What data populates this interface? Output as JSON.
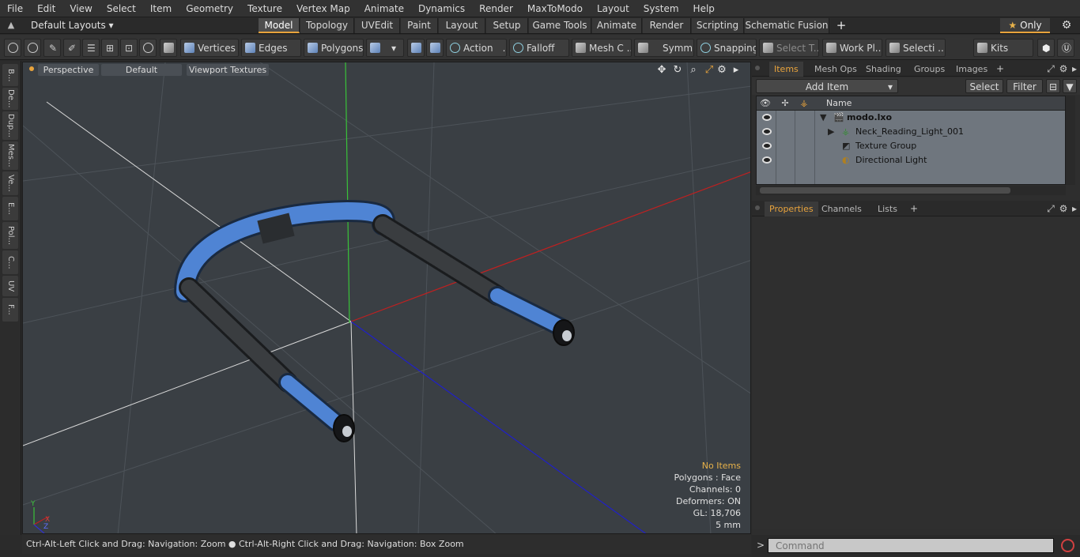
{
  "menu": [
    "File",
    "Edit",
    "View",
    "Select",
    "Item",
    "Geometry",
    "Texture",
    "Vertex Map",
    "Animate",
    "Dynamics",
    "Render",
    "MaxToModo",
    "Layout",
    "System",
    "Help"
  ],
  "layouts": {
    "label": "Default Layouts"
  },
  "mode_tabs": [
    "Model",
    "Topology",
    "UVEdit",
    "Paint",
    "Layout",
    "Setup",
    "Game Tools",
    "Animate",
    "Render",
    "Scripting",
    "Schematic Fusion"
  ],
  "mode_active": "Model",
  "only_label": "Only",
  "toolbar": {
    "vertices": "Vertices",
    "edges": "Edges",
    "polygons": "Polygons",
    "action": "Action",
    "falloff": "Falloff",
    "mesh": "Mesh C ...",
    "symm": "Symm ...",
    "snapping": "Snapping",
    "select_t": "Select T...",
    "work_pl": "Work Pl...",
    "selecti": "Selecti ...",
    "kits": "Kits",
    "action_more": "..."
  },
  "left_tabs": [
    "B...",
    "De...",
    "Dup...",
    "Mes...",
    "Ve...",
    "E...",
    "Pol...",
    "C...",
    "UV",
    "F..."
  ],
  "viewport": {
    "view": "Perspective",
    "shading": "Default",
    "textures": "Viewport Textures",
    "hud": {
      "selection": "No Items",
      "polygons": "Polygons : Face",
      "channels": "Channels: 0",
      "deformers": "Deformers: ON",
      "gl": "GL: 18,706",
      "units": "5 mm"
    },
    "axis": {
      "x": "X",
      "y": "Y",
      "z": "Z"
    }
  },
  "status": {
    "hint": "Ctrl-Alt-Left Click and Drag: Navigation: Zoom ● Ctrl-Alt-Right Click and Drag: Navigation: Box Zoom"
  },
  "items_panel": {
    "tabs": [
      "Items",
      "Mesh Ops",
      "Shading",
      "Groups",
      "Images"
    ],
    "active": "Items",
    "add_item": "Add Item",
    "select": "Select",
    "filter": "Filter",
    "name_header": "Name",
    "tree": [
      {
        "label": "modo.lxo",
        "bold": true
      },
      {
        "label": "Neck_Reading_Light_001",
        "bold": false
      },
      {
        "label": "Texture Group",
        "bold": false
      },
      {
        "label": "Directional Light",
        "bold": false
      }
    ]
  },
  "props_panel": {
    "tabs": [
      "Properties",
      "Channels",
      "Lists"
    ],
    "active": "Properties"
  },
  "command": {
    "placeholder": "Command"
  },
  "colors": {
    "accent": "#e8a33c",
    "mesh_blue": "#4f84d4",
    "grip": "#222222"
  }
}
